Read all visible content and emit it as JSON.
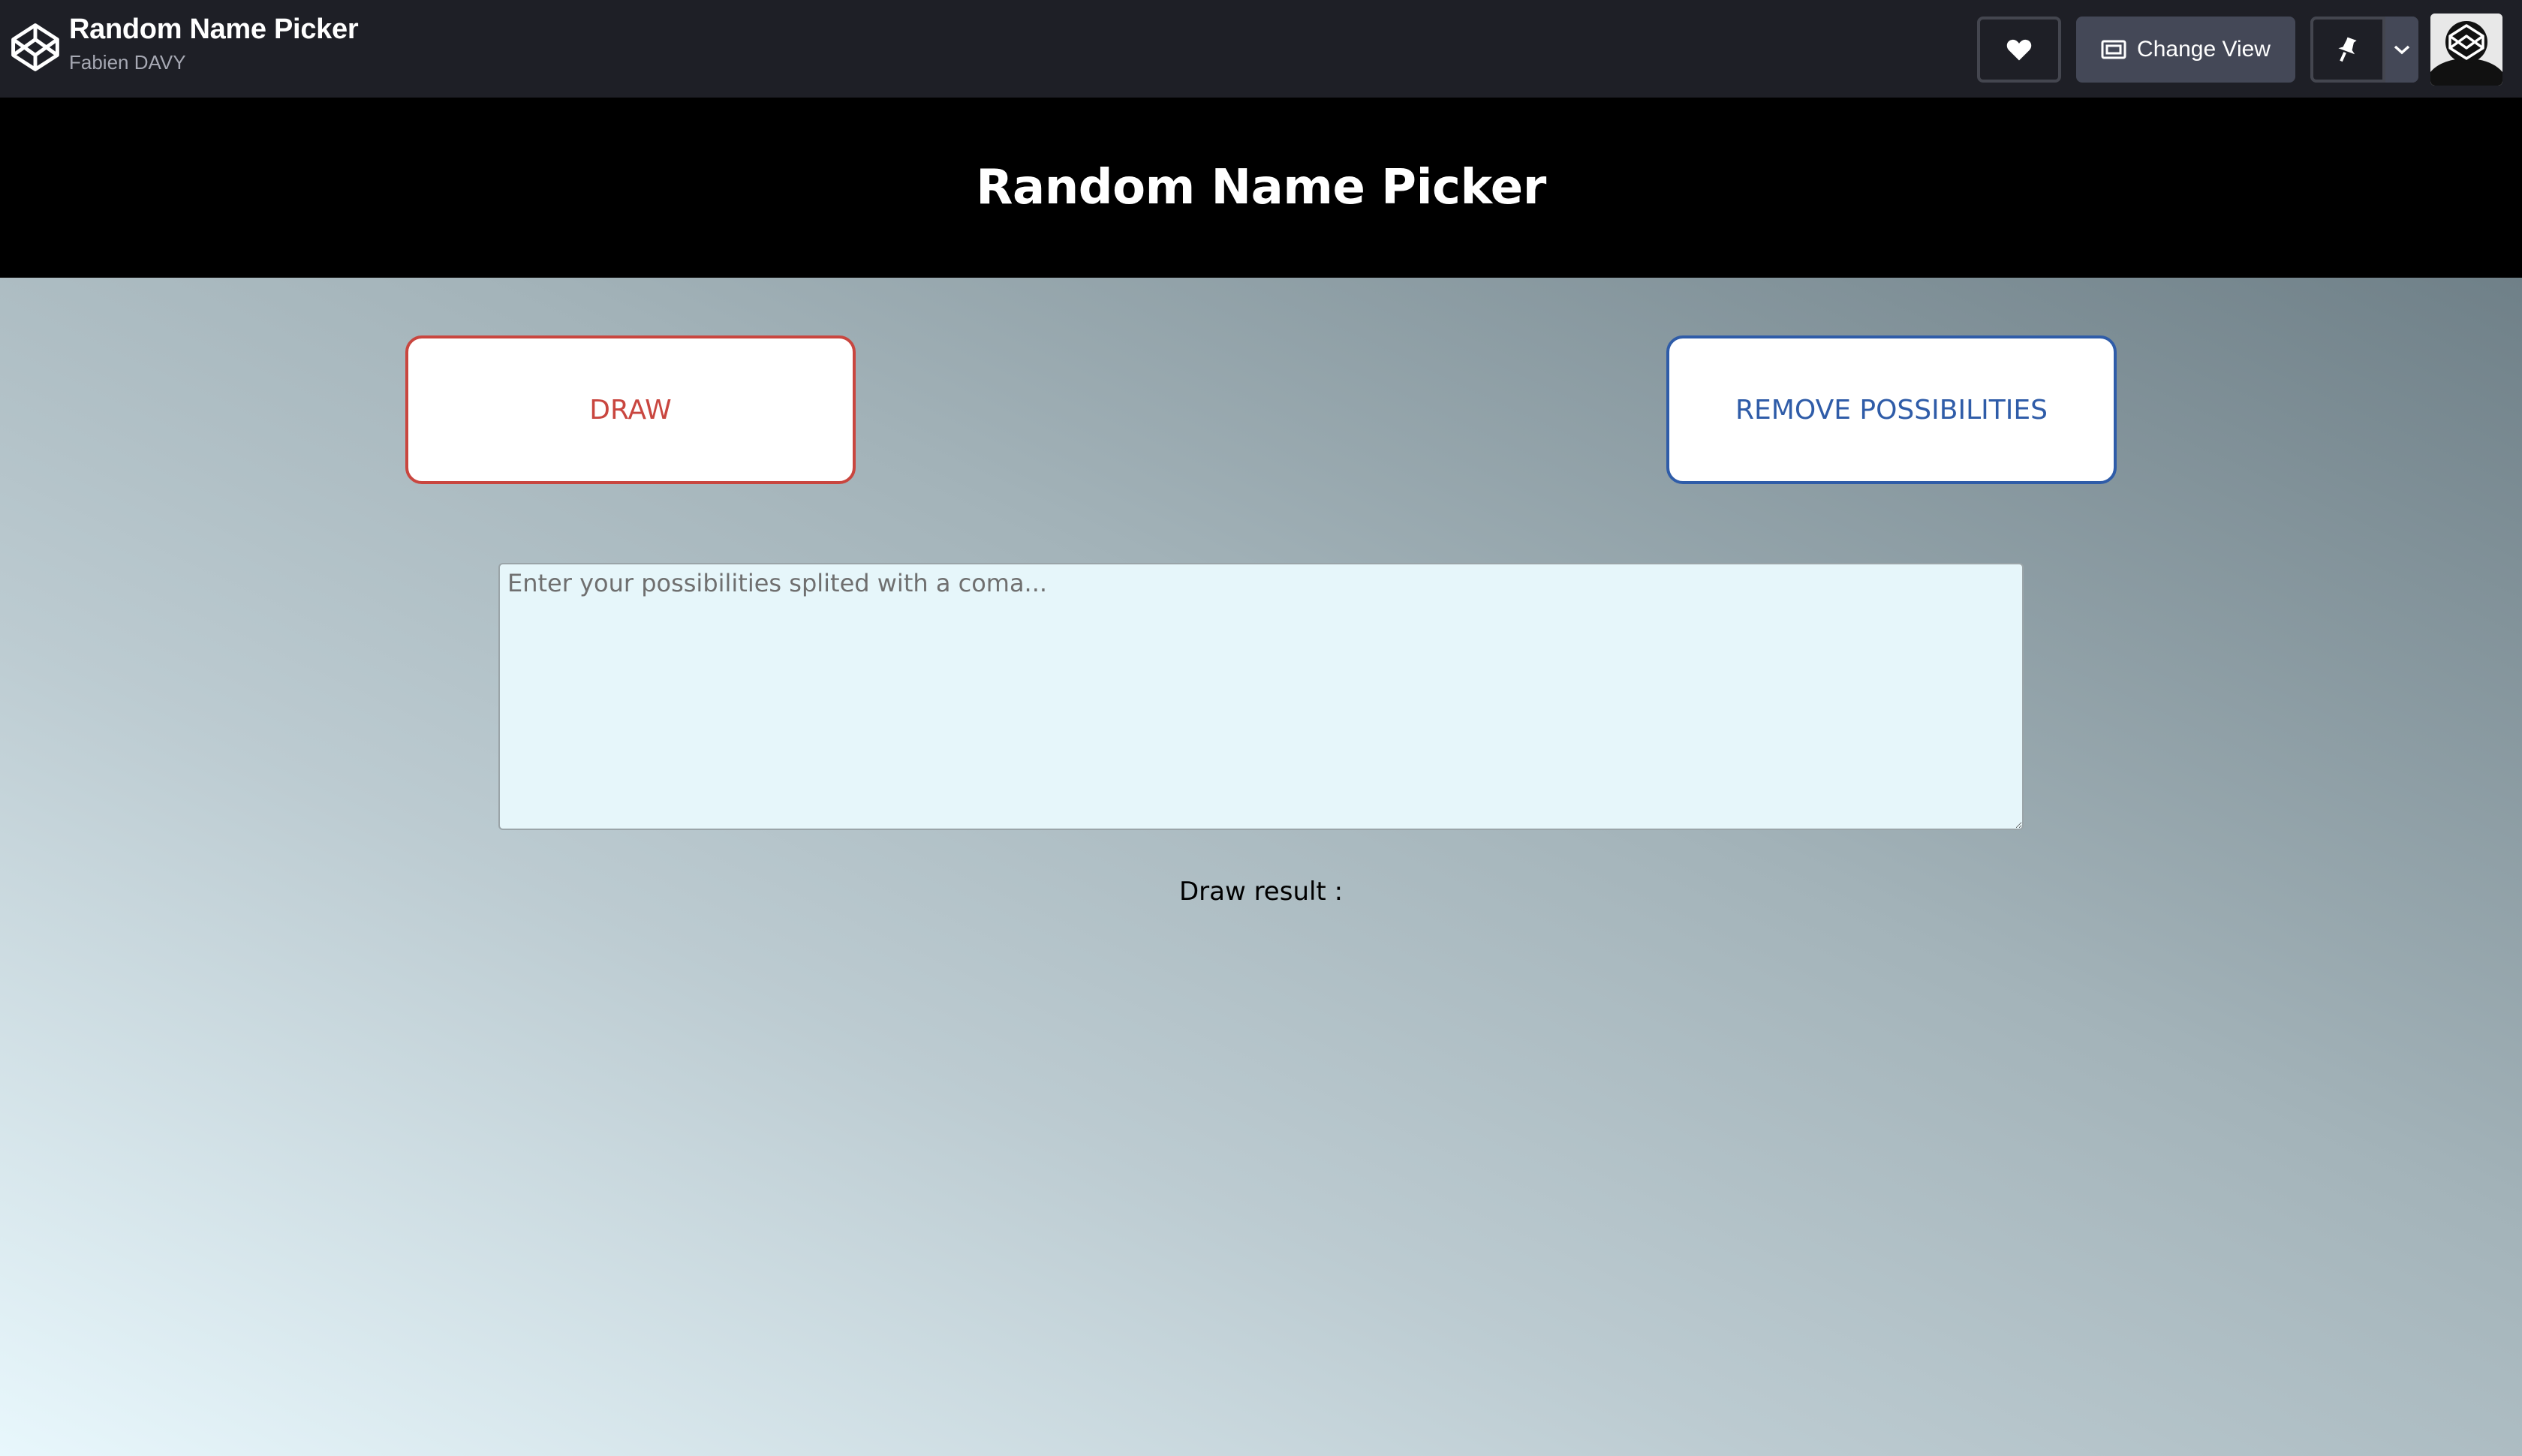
{
  "topbar": {
    "title": "Random Name Picker",
    "author": "Fabien DAVY",
    "change_view_label": "Change View",
    "icons": {
      "logo": "codepen-logo-icon",
      "heart": "heart-icon",
      "change_view": "window-view-icon",
      "pin": "pin-icon",
      "dropdown": "chevron-down-icon",
      "avatar": "user-avatar"
    }
  },
  "page": {
    "title": "Random Name Picker",
    "draw_label": "DRAW",
    "remove_label": "REMOVE POSSIBILITIES",
    "textarea_placeholder": "Enter your possibilities splited with a coma...",
    "textarea_value": "",
    "result_label": "Draw result :"
  },
  "colors": {
    "topbar_bg": "#1e1f26",
    "header_bg": "#000000",
    "draw_accent": "#c9463f",
    "remove_accent": "#2f5ca8",
    "textarea_bg": "#e6f6fa"
  }
}
